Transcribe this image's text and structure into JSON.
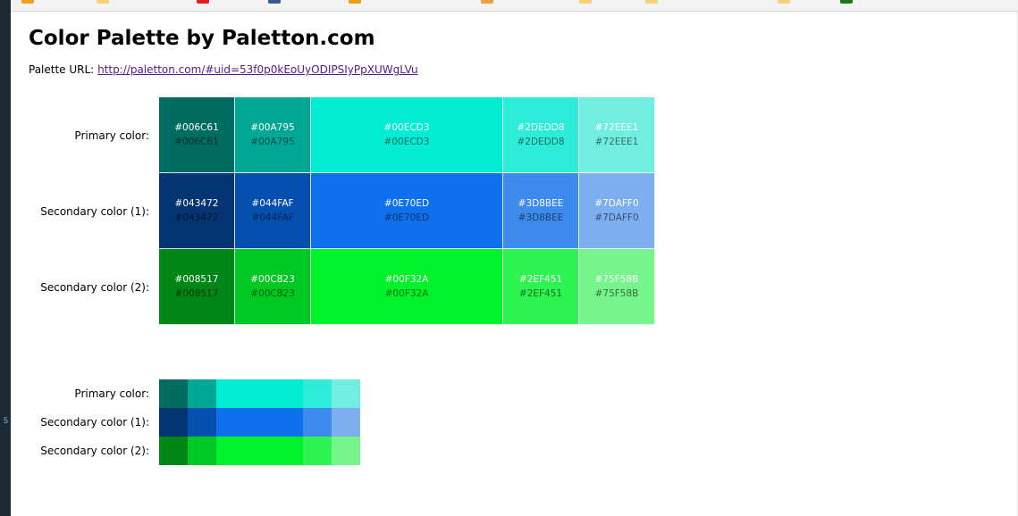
{
  "page": {
    "title": "Color Palette by Paletton.com",
    "url_label": "Palette URL:",
    "url_text": "http://paletton.com/#uid=53f0p0kEoUyODIPSIyPpXUWgLVu"
  },
  "rows": [
    {
      "label": "Primary color:",
      "cells": [
        {
          "top": "#006C61",
          "bottom": "#006C61",
          "color": "#006C61"
        },
        {
          "top": "#00A795",
          "bottom": "#00A795",
          "color": "#00A795"
        },
        {
          "top": "#00ECD3",
          "bottom": "#00ECD3",
          "color": "#00ECD3"
        },
        {
          "top": "#2DEDD8",
          "bottom": "#2DEDD8",
          "color": "#2DEDD8"
        },
        {
          "top": "#72EEE1",
          "bottom": "#72EEE1",
          "color": "#72EEE1"
        }
      ]
    },
    {
      "label": "Secondary color (1):",
      "cells": [
        {
          "top": "#043472",
          "bottom": "#043472",
          "color": "#043472"
        },
        {
          "top": "#044FAF",
          "bottom": "#044FAF",
          "color": "#044FAF"
        },
        {
          "top": "#0E70ED",
          "bottom": "#0E70ED",
          "color": "#0E70ED"
        },
        {
          "top": "#3D8BEE",
          "bottom": "#3D8BEE",
          "color": "#3D8BEE"
        },
        {
          "top": "#7DAFF0",
          "bottom": "#7DAFF0",
          "color": "#7DAFF0"
        }
      ]
    },
    {
      "label": "Secondary color (2):",
      "cells": [
        {
          "top": "#008517",
          "bottom": "#008517",
          "color": "#008517"
        },
        {
          "top": "#00C823",
          "bottom": "#00C823",
          "color": "#00C823"
        },
        {
          "top": "#00F32A",
          "bottom": "#00F32A",
          "color": "#00F32A"
        },
        {
          "top": "#2EF451",
          "bottom": "#2EF451",
          "color": "#2EF451"
        },
        {
          "top": "#75F58B",
          "bottom": "#75F58B",
          "color": "#75F58B"
        }
      ]
    }
  ],
  "mini_rows": [
    {
      "label": "Primary color:"
    },
    {
      "label": "Secondary color (1):"
    },
    {
      "label": "Secondary color (2):"
    }
  ],
  "browser": {
    "left_strip_char": "5",
    "bookmark_colors": [
      "#f0a020",
      "#f5d27a",
      "#e02020",
      "#3b5998",
      "#f09a1a",
      "#e8a040",
      "#f5d27a",
      "#f5d27a",
      "#f5d27a",
      "#1a7a1a"
    ]
  }
}
